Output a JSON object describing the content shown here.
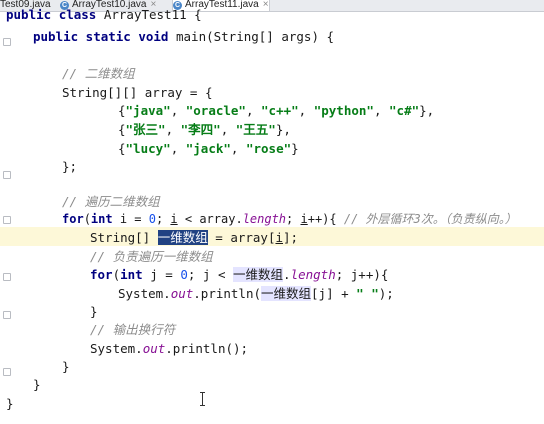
{
  "tabs": [
    {
      "icon": "C",
      "label": "Test09.java"
    },
    {
      "icon": "C",
      "label": "ArrayTest10.java"
    },
    {
      "icon": "C",
      "label": "ArrayTest11.java"
    }
  ],
  "code": {
    "l0_kw1": "public",
    "l0_kw2": "class",
    "l0_name": "ArrayTest11 {",
    "l1_kw": "public static void",
    "l1_rest": " main(String[] args) {",
    "l3_cmt": "// 二维数组",
    "l4": "String[][] array = {",
    "l5_a": "{",
    "l5_s1": "\"java\"",
    "l5_c1": ", ",
    "l5_s2": "\"oracle\"",
    "l5_c2": ", ",
    "l5_s3": "\"c++\"",
    "l5_c3": ", ",
    "l5_s4": "\"python\"",
    "l5_c4": ", ",
    "l5_s5": "\"c#\"",
    "l5_end": "},",
    "l6_a": "{",
    "l6_s1": "\"张三\"",
    "l6_c1": ", ",
    "l6_s2": "\"李四\"",
    "l6_c2": ", ",
    "l6_s3": "\"王五\"",
    "l6_end": "},",
    "l7_a": "{",
    "l7_s1": "\"lucy\"",
    "l7_c1": ", ",
    "l7_s2": "\"jack\"",
    "l7_c2": ", ",
    "l7_s3": "\"rose\"",
    "l7_end": "}",
    "l8": "};",
    "l10_cmt": "// 遍历二维数组",
    "l11_for": "for",
    "l11_p1": "(",
    "l11_int": "int",
    "l11_p2": " i = ",
    "l11_zero": "0",
    "l11_p3": "; ",
    "l11_i": "i",
    "l11_p4": " < array.",
    "l11_len": "length",
    "l11_p5": "; ",
    "l11_i2": "i",
    "l11_p6": "++){ ",
    "l11_cmt": "// 外层循环3次。（负责纵向。）",
    "l12_a": "String[] ",
    "l12_sel": "一维数组",
    "l12_b": " = array[",
    "l12_i": "i",
    "l12_c": "];",
    "l13_cmt": "// 负责遍历一维数组",
    "l14_for": "for",
    "l14_p1": "(",
    "l14_int": "int",
    "l14_p2": " j = ",
    "l14_zero": "0",
    "l14_p3": "; j < ",
    "l14_arr": "一维数组",
    "l14_p4": ".",
    "l14_len": "length",
    "l14_p5": "; j++){",
    "l15_a": "System.",
    "l15_out": "out",
    "l15_b": ".println(",
    "l15_arr": "一维数组",
    "l15_c": "[j] + ",
    "l15_str": "\" \"",
    "l15_d": ");",
    "l16": "}",
    "l17_cmt": "// 输出换行符",
    "l18_a": "System.",
    "l18_out": "out",
    "l18_b": ".println();",
    "l19": "}",
    "l20": "}",
    "l21": "}"
  },
  "colors": {
    "keyword": "#000080",
    "string": "#067d17",
    "comment": "#8c8c8c",
    "selection": "#214283",
    "current_line": "#fdf8d8"
  }
}
